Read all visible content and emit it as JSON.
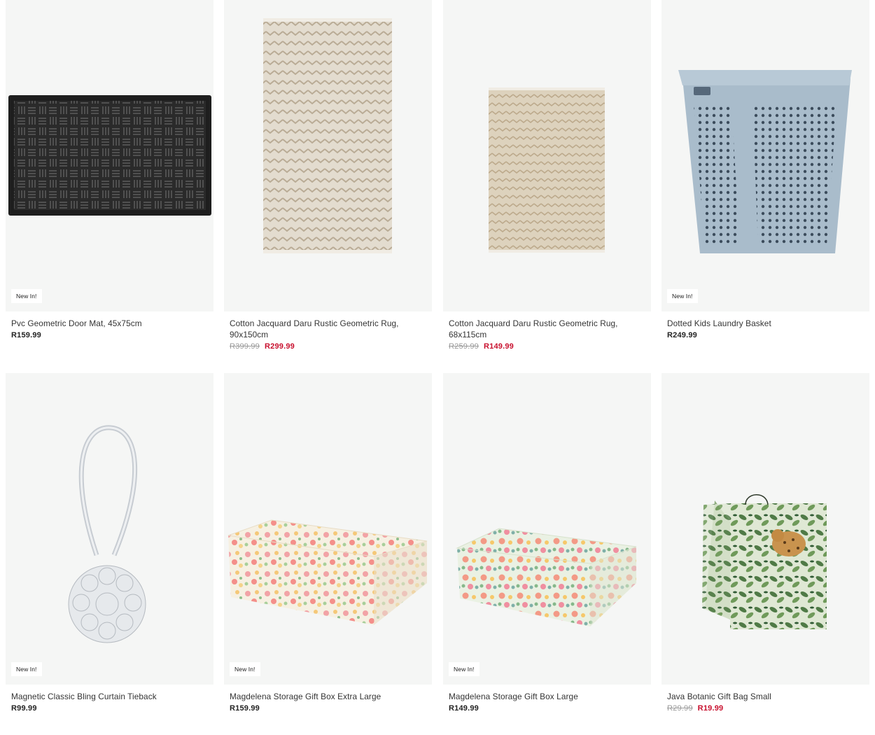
{
  "colors": {
    "tile_bg": "#f5f6f5",
    "sale_red": "#c8102e",
    "old_grey": "#999999"
  },
  "products": [
    {
      "icon": "door-mat-image",
      "badge": "New In!",
      "title": "Pvc Geometric Door Mat, 45x75cm",
      "price": "R159.99",
      "old_price": "",
      "sale_price": ""
    },
    {
      "icon": "rug-large-image",
      "badge": "",
      "title": "Cotton Jacquard Daru Rustic Geometric Rug, 90x150cm",
      "price": "",
      "old_price": "R399.99",
      "sale_price": "R299.99"
    },
    {
      "icon": "rug-small-image",
      "badge": "",
      "title": "Cotton Jacquard Daru Rustic Geometric Rug, 68x115cm",
      "price": "",
      "old_price": "R259.99",
      "sale_price": "R149.99"
    },
    {
      "icon": "laundry-basket-image",
      "badge": "New In!",
      "title": "Dotted Kids Laundry Basket",
      "price": "R249.99",
      "old_price": "",
      "sale_price": ""
    },
    {
      "icon": "curtain-tieback-image",
      "badge": "New In!",
      "title": "Magnetic Classic Bling Curtain Tieback",
      "price": "R99.99",
      "old_price": "",
      "sale_price": ""
    },
    {
      "icon": "gift-box-xl-image",
      "badge": "New In!",
      "title": "Magdelena Storage Gift Box Extra Large",
      "price": "R159.99",
      "old_price": "",
      "sale_price": ""
    },
    {
      "icon": "gift-box-large-image",
      "badge": "New In!",
      "title": "Magdelena Storage Gift Box Large",
      "price": "R149.99",
      "old_price": "",
      "sale_price": ""
    },
    {
      "icon": "gift-bag-image",
      "badge": "",
      "title": "Java Botanic Gift Bag Small",
      "price": "",
      "old_price": "R29.99",
      "sale_price": "R19.99"
    }
  ]
}
